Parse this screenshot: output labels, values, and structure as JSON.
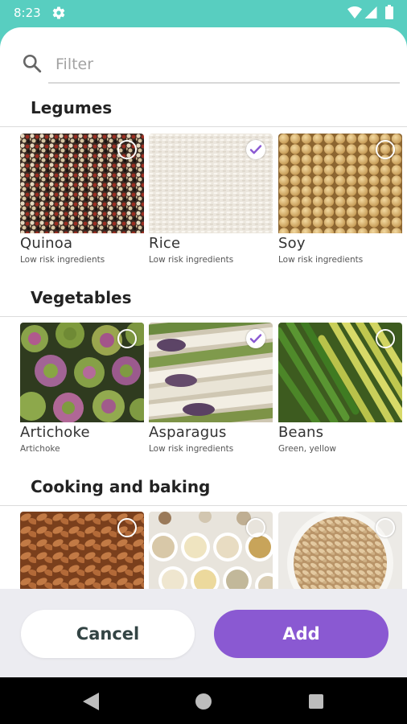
{
  "status_bar": {
    "time": "8:23",
    "icons": [
      "gear-icon",
      "wifi-icon",
      "signal-icon",
      "battery-icon"
    ]
  },
  "search": {
    "placeholder": "Filter",
    "value": ""
  },
  "sections": [
    {
      "title": "Legumes",
      "items": [
        {
          "title": "Quinoa",
          "subtitle": "Low risk ingredients",
          "checked": false
        },
        {
          "title": "Rice",
          "subtitle": "Low risk ingredients",
          "checked": true
        },
        {
          "title": "Soy",
          "subtitle": "Low risk ingredients",
          "checked": false
        }
      ]
    },
    {
      "title": "Vegetables",
      "items": [
        {
          "title": "Artichoke",
          "subtitle": "Artichoke",
          "checked": false
        },
        {
          "title": "Asparagus",
          "subtitle": "Low risk ingredients",
          "checked": true
        },
        {
          "title": "Beans",
          "subtitle": "Green, yellow",
          "checked": false
        }
      ]
    },
    {
      "title": "Cooking and baking",
      "items": [
        {
          "title": "",
          "subtitle": "",
          "checked": false
        },
        {
          "title": "",
          "subtitle": "",
          "checked": false
        },
        {
          "title": "",
          "subtitle": "",
          "checked": false
        }
      ]
    }
  ],
  "actions": {
    "cancel_label": "Cancel",
    "add_label": "Add"
  },
  "colors": {
    "status_bar": "#58cec0",
    "accent": "#8a59d2",
    "action_bar": "#ececf1"
  }
}
